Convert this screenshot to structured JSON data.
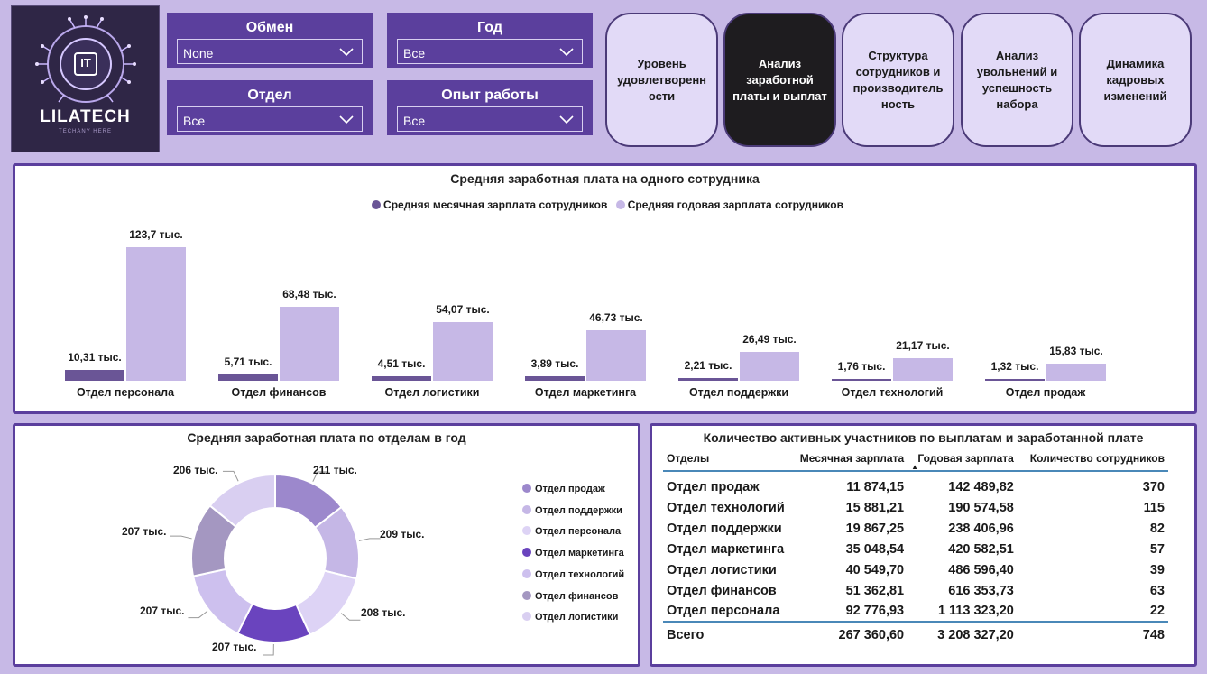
{
  "logo": {
    "text": "LILATECH",
    "sub": "TECHANY HERE",
    "badge": "IT"
  },
  "slicers": [
    {
      "title": "Обмен",
      "value": "None"
    },
    {
      "title": "Год",
      "value": "Все"
    },
    {
      "title": "Отдел",
      "value": "Все"
    },
    {
      "title": "Опыт работы",
      "value": "Все"
    }
  ],
  "nav": [
    {
      "label": "Уровень удовлетворенн ости",
      "active": false
    },
    {
      "label": "Анализ заработной платы и выплат",
      "active": true
    },
    {
      "label": "Структура сотрудников и производитель ность",
      "active": false
    },
    {
      "label": "Анализ увольнений и успешность набора",
      "active": false
    },
    {
      "label": "Динамика кадровых изменений",
      "active": false
    }
  ],
  "colors": {
    "monthly": "#6a5596",
    "annual": "#c6b8e6",
    "accent": "#5b3f9d"
  },
  "chart_data": [
    {
      "type": "bar",
      "title": "Средняя заработная плата на одного сотрудника",
      "categories": [
        "Отдел персонала",
        "Отдел финансов",
        "Отдел логистики",
        "Отдел маркетинга",
        "Отдел поддержки",
        "Отдел технологий",
        "Отдел продаж"
      ],
      "series": [
        {
          "name": "Средняя месячная зарплата сотрудников",
          "values": [
            10.31,
            5.71,
            4.51,
            3.89,
            2.21,
            1.76,
            1.32
          ],
          "labels": [
            "10,31 тыс.",
            "5,71 тыс.",
            "4,51 тыс.",
            "3,89 тыс.",
            "2,21 тыс.",
            "1,76 тыс.",
            "1,32 тыс."
          ]
        },
        {
          "name": "Средняя годовая зарплата сотрудников",
          "values": [
            123.7,
            68.48,
            54.07,
            46.73,
            26.49,
            21.17,
            15.83
          ],
          "labels": [
            "123,7 тыс.",
            "68,48 тыс.",
            "54,07 тыс.",
            "46,73 тыс.",
            "26,49 тыс.",
            "21,17 тыс.",
            "15,83 тыс."
          ]
        }
      ],
      "legend": "top-center"
    },
    {
      "type": "pie",
      "title": "Средняя заработная плата по отделам в год",
      "slices": [
        {
          "name": "Отдел продаж",
          "value": 211,
          "label": "211 тыс.",
          "color": "#9c88cc"
        },
        {
          "name": "Отдел поддержки",
          "value": 209,
          "label": "209 тыс.",
          "color": "#c5b7e6"
        },
        {
          "name": "Отдел персонала",
          "value": 208,
          "label": "208 тыс.",
          "color": "#ddd3f5"
        },
        {
          "name": "Отдел маркетинга",
          "value": 207,
          "label": "207 тыс.",
          "color": "#6a44be"
        },
        {
          "name": "Отдел технологий",
          "value": 207,
          "label": "207 тыс.",
          "color": "#cdc0ee"
        },
        {
          "name": "Отдел финансов",
          "value": 207,
          "label": "207 тыс.",
          "color": "#a497c1"
        },
        {
          "name": "Отдел логистики",
          "value": 206,
          "label": "206 тыс.",
          "color": "#d9cff1"
        }
      ],
      "legend": "right"
    }
  ],
  "table": {
    "title": "Количество активных участников по выплатам и заработанной плате",
    "headers": [
      "Отделы",
      "Месячная зарплата",
      "Годовая зарплата",
      "Количество сотрудников"
    ],
    "rows": [
      [
        "Отдел продаж",
        "11 874,15",
        "142 489,82",
        "370"
      ],
      [
        "Отдел технологий",
        "15 881,21",
        "190 574,58",
        "115"
      ],
      [
        "Отдел поддержки",
        "19 867,25",
        "238 406,96",
        "82"
      ],
      [
        "Отдел маркетинга",
        "35 048,54",
        "420 582,51",
        "57"
      ],
      [
        "Отдел логистики",
        "40 549,70",
        "486 596,40",
        "39"
      ],
      [
        "Отдел финансов",
        "51 362,81",
        "616 353,73",
        "63"
      ],
      [
        "Отдел персонала",
        "92 776,93",
        "1 113 323,20",
        "22"
      ]
    ],
    "total": [
      "Всего",
      "267 360,60",
      "3 208 327,20",
      "748"
    ]
  }
}
